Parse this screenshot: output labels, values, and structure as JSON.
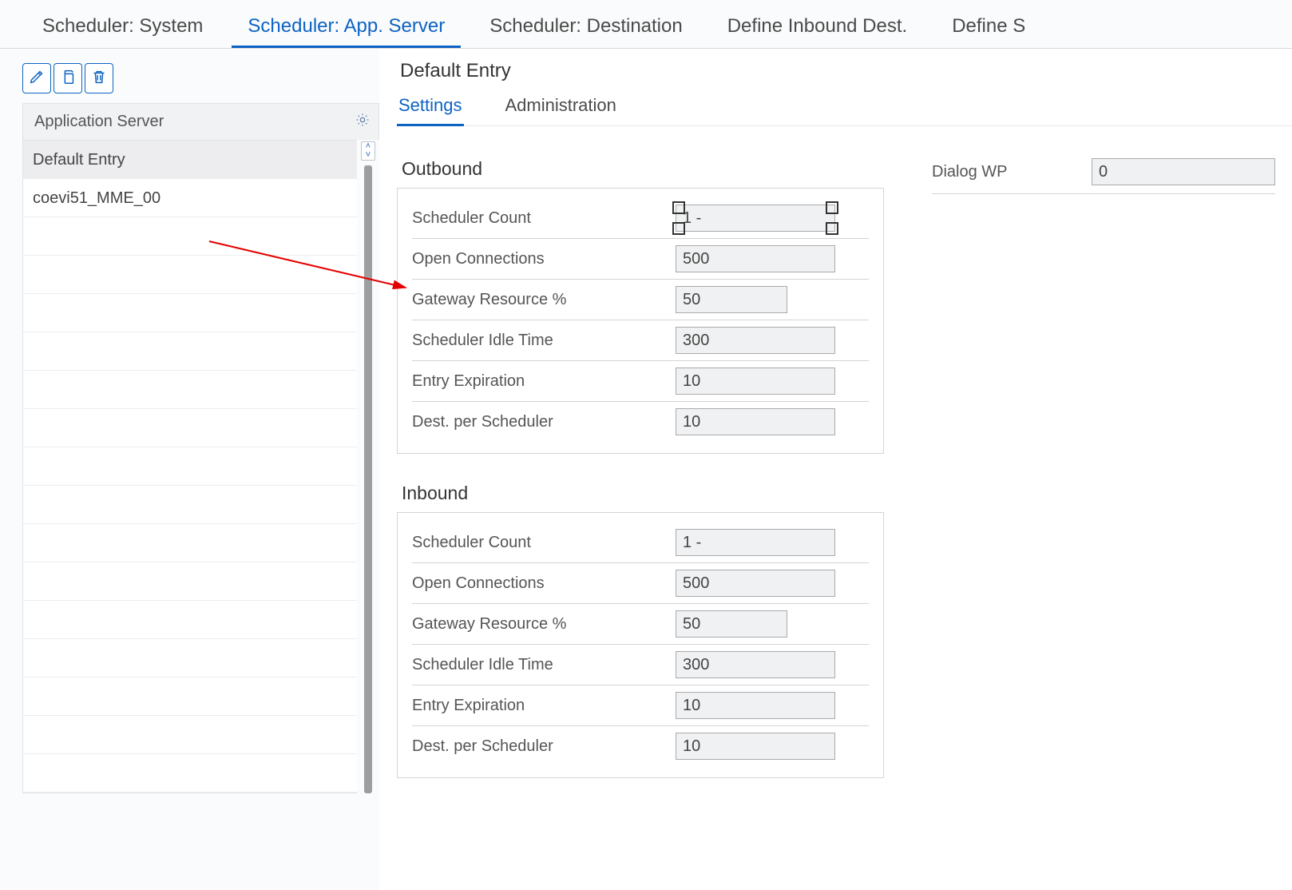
{
  "topTabs": {
    "t0": "Scheduler: System",
    "t1": "Scheduler: App. Server",
    "t2": "Scheduler: Destination",
    "t3": "Define Inbound Dest.",
    "t4": "Define S"
  },
  "left": {
    "header": "Application Server",
    "row0": "Default Entry",
    "row1": "coevi51_MME_00"
  },
  "right": {
    "title": "Default Entry",
    "subtabs": {
      "settings": "Settings",
      "admin": "Administration"
    },
    "outboundTitle": "Outbound",
    "inboundTitle": "Inbound",
    "labels": {
      "schedCount": "Scheduler Count",
      "openConn": "Open Connections",
      "gwRes": "Gateway Resource %",
      "idle": "Scheduler Idle Time",
      "expire": "Entry Expiration",
      "destPer": "Dest. per Scheduler",
      "dialogWP": "Dialog WP"
    },
    "outbound": {
      "schedCount": "1 -",
      "openConn": "500",
      "gwRes": "50",
      "idle": "300",
      "expire": "10",
      "destPer": "10"
    },
    "inbound": {
      "schedCount": "1 -",
      "openConn": "500",
      "gwRes": "50",
      "idle": "300",
      "expire": "10",
      "destPer": "10"
    },
    "dialogWP": "0"
  }
}
